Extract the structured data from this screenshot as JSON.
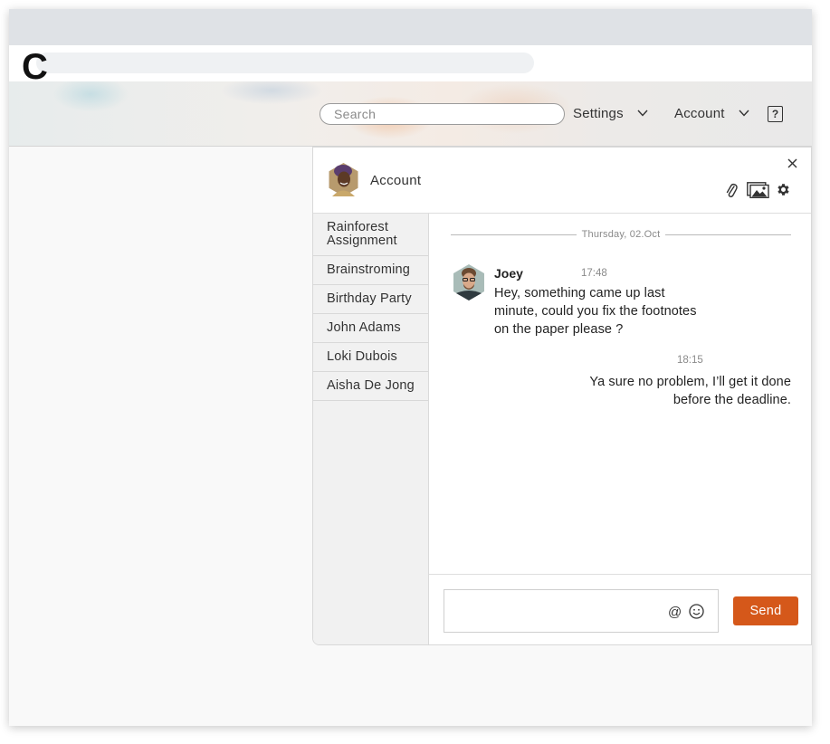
{
  "app": {
    "logo_text": "C"
  },
  "header": {
    "search_placeholder": "Search",
    "settings_label": "Settings",
    "account_label": "Account",
    "help_label": "?"
  },
  "panel": {
    "title": "Account",
    "chats": [
      "Rainforest Assignment",
      "Brainstroming",
      "Birthday Party",
      "John Adams",
      "Loki Dubois",
      "Aisha De Jong"
    ],
    "date_separator": "Thursday, 02.Oct",
    "messages": [
      {
        "sender": "Joey",
        "time": "17:48",
        "text": "Hey, something came up last minute, could you fix the footnotes on the paper please ?"
      },
      {
        "time": "18:15",
        "text": "Ya sure no problem, I’ll get it done before the deadline."
      }
    ],
    "composer": {
      "mention_symbol": "@",
      "send_label": "Send"
    }
  },
  "icons": {
    "paperclip": "paperclip-icon",
    "image": "image-icon",
    "gear": "gear-icon",
    "close": "close-icon",
    "emoji": "emoji-icon"
  },
  "colors": {
    "accent": "#d5581a",
    "topbar": "#dfe2e6",
    "sidebar": "#f1f1f1"
  }
}
